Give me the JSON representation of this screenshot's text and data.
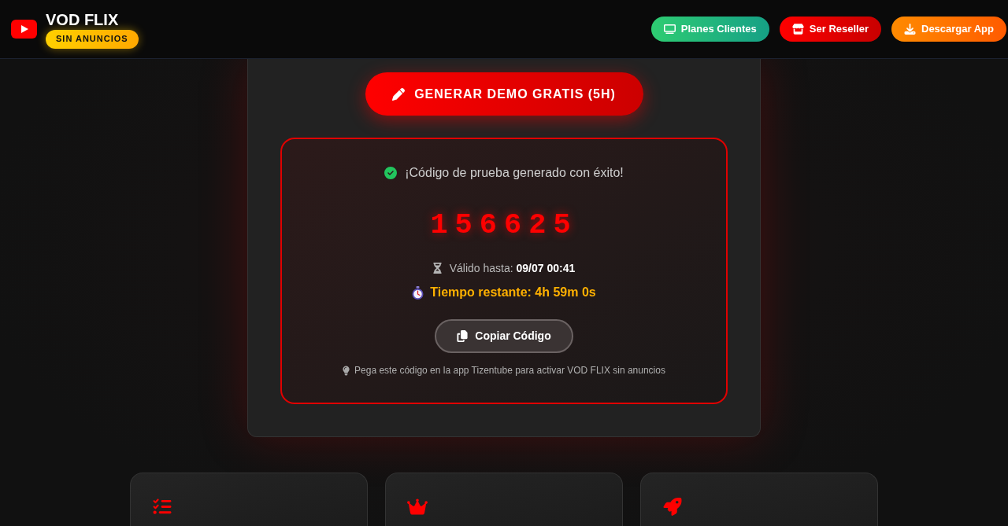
{
  "header": {
    "logo": {
      "title": "VOD FLIX",
      "badge": "SIN ANUNCIOS"
    },
    "nav_buttons": [
      {
        "label": "Planes Clientes",
        "kind": "plans"
      },
      {
        "label": "Ser Reseller",
        "kind": "reseller"
      },
      {
        "label": "Descargar App",
        "kind": "download"
      }
    ]
  },
  "demo_panel": {
    "generate_button": "GENERAR DEMO GRATIS (5H)",
    "result": {
      "status": "¡Código de prueba generado con éxito!",
      "code": "156625",
      "valid_until": "Válido hasta: **09/07 00:41**",
      "time_remaining": "Tiempo restante: 4h 59m 0s",
      "copy_button": "Copiar Código",
      "hint": "Pega este código en la app Tizentube para activar VOD FLIX sin anuncios"
    }
  },
  "feature_cards": [
    {
      "kind": "checklist"
    },
    {
      "kind": "crown"
    },
    {
      "kind": "rocket"
    }
  ]
}
